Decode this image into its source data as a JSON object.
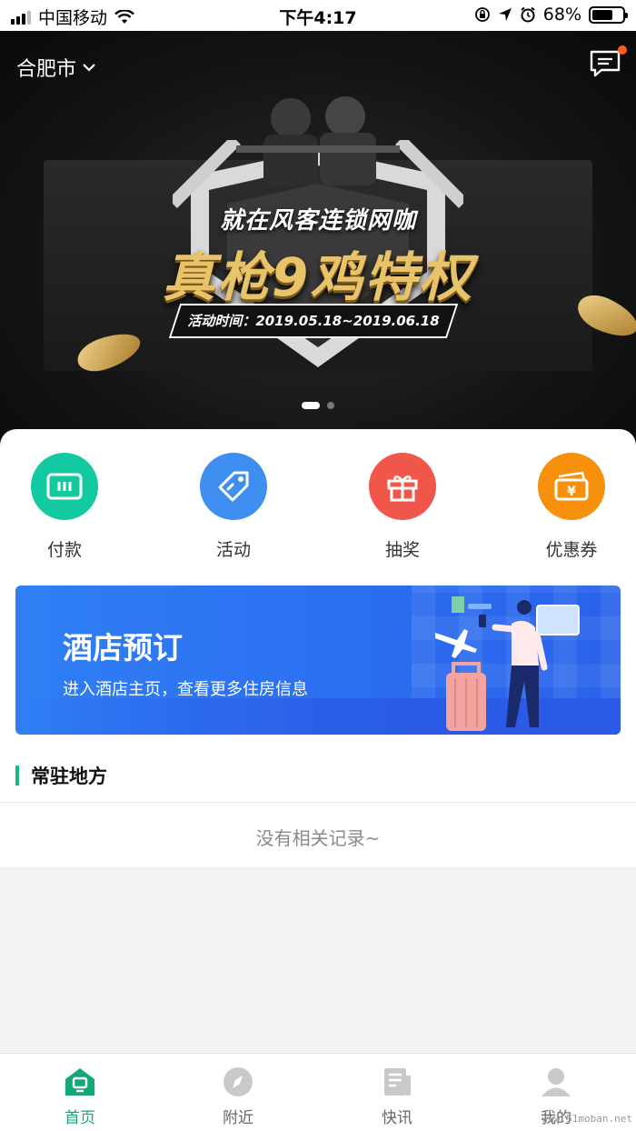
{
  "status_bar": {
    "carrier": "中国移动",
    "time": "下午4:17",
    "battery_percent": "68%",
    "battery_level": 0.68
  },
  "header": {
    "city": "合肥市",
    "message_icon": "message-icon"
  },
  "banner": {
    "headline_top": "就在风客连锁网咖",
    "headline_main": "真枪9鸡特权",
    "date_text": "活动时间：2019.05.18~2019.06.18",
    "page_index": 1,
    "page_count": 2
  },
  "quick_actions": [
    {
      "label": "付款",
      "icon": "payment-card-icon",
      "color": "#13c9a0"
    },
    {
      "label": "活动",
      "icon": "tag-icon",
      "color": "#3f8ff0"
    },
    {
      "label": "抽奖",
      "icon": "gift-icon",
      "color": "#f0564a"
    },
    {
      "label": "优惠券",
      "icon": "coupon-icon",
      "color": "#f7900d"
    }
  ],
  "hotel_banner": {
    "title": "酒店预订",
    "subtitle": "进入酒店主页，查看更多住房信息"
  },
  "section": {
    "title": "常驻地方",
    "empty_text": "没有相关记录~"
  },
  "tabbar": [
    {
      "label": "首页",
      "icon": "home-icon",
      "active": true
    },
    {
      "label": "附近",
      "icon": "compass-icon",
      "active": false
    },
    {
      "label": "快讯",
      "icon": "news-icon",
      "active": false
    },
    {
      "label": "我的",
      "icon": "user-icon",
      "active": false
    }
  ],
  "watermark": "www.51moban.net",
  "colors": {
    "accent": "#14a77a",
    "section_bar": "#12b886",
    "hotel_blue": "#2b6df0"
  }
}
